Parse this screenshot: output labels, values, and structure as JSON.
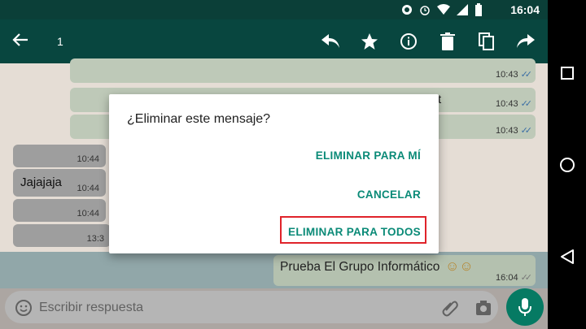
{
  "statusbar": {
    "time": "16:04"
  },
  "appbar": {
    "selected_count": "1"
  },
  "chat": {
    "messages": [
      {
        "text": "",
        "time": "10:43"
      },
      {
        "text": "t",
        "time": "10:43"
      },
      {
        "text": "",
        "time": "10:43"
      },
      {
        "text": "",
        "time": "10:44"
      },
      {
        "text": "Jajajaja",
        "time": "10:44"
      },
      {
        "text": "",
        "time": "10:44"
      },
      {
        "text": "",
        "time": "13:3"
      },
      {
        "text": "Prueba El Grupo Informático",
        "emoji": "☺☺",
        "time": "16:04"
      }
    ]
  },
  "composer": {
    "placeholder": "Escribir respuesta"
  },
  "dialog": {
    "title": "¿Eliminar este mensaje?",
    "buttons": {
      "delete_for_me": "ELIMINAR PARA MÍ",
      "cancel": "CANCELAR",
      "delete_for_all": "ELIMINAR PARA TODOS"
    }
  },
  "colors": {
    "appbar": "#08463f",
    "accent": "#0a8a77",
    "highlight_box": "#e0232a",
    "mic_button": "#067a63"
  },
  "icons": {
    "appbar": [
      "arrow-back-icon",
      "reply-icon",
      "star-icon",
      "info-icon",
      "delete-icon",
      "copy-icon",
      "forward-icon"
    ],
    "navbar": [
      "recents-icon",
      "home-icon",
      "back-icon"
    ]
  }
}
